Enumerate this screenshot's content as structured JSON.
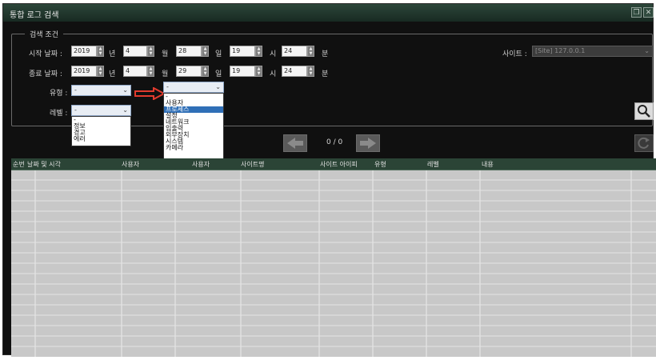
{
  "window": {
    "title": "통합 로그 검색"
  },
  "criteria": {
    "legend": "검색 조건",
    "start": {
      "label": "시작 날짜 :",
      "year": "2019",
      "year_unit": "년",
      "month": "4",
      "month_unit": "월",
      "day": "28",
      "day_unit": "일",
      "hour": "19",
      "hour_unit": "시",
      "minute": "24",
      "minute_unit": "분"
    },
    "end": {
      "label": "종료 날짜 :",
      "year": "2019",
      "year_unit": "년",
      "month": "4",
      "month_unit": "월",
      "day": "29",
      "day_unit": "일",
      "hour": "19",
      "hour_unit": "시",
      "minute": "24",
      "minute_unit": "분"
    },
    "site_label": "사이트 :",
    "site_value": "[Site] 127.0.0.1",
    "type_label": "유형 :",
    "type_value": "-",
    "level_label": "레벨 :",
    "level_value": "-",
    "secondary_combo_value": "-"
  },
  "level_dropdown": {
    "items": [
      "-",
      "정보",
      "경고",
      "에러"
    ]
  },
  "type_dropdown": {
    "items": [
      "-",
      "사용자",
      "프로세스",
      "설정",
      "네트워크",
      "입출력",
      "외부장치",
      "시스템",
      "카메라"
    ],
    "selected_index": 2
  },
  "paging": {
    "text": "0 / 0"
  },
  "columns": [
    "순번",
    "날짜 및 시각",
    "사용자",
    "사용자",
    "사이트명",
    "사이트 아이피",
    "유형",
    "레벨",
    "내용"
  ],
  "colors": {
    "title_bg": "#2c463a",
    "header_bg": "#2b4436",
    "selection": "#2f6fb7",
    "arrow": "#e23b2e"
  }
}
